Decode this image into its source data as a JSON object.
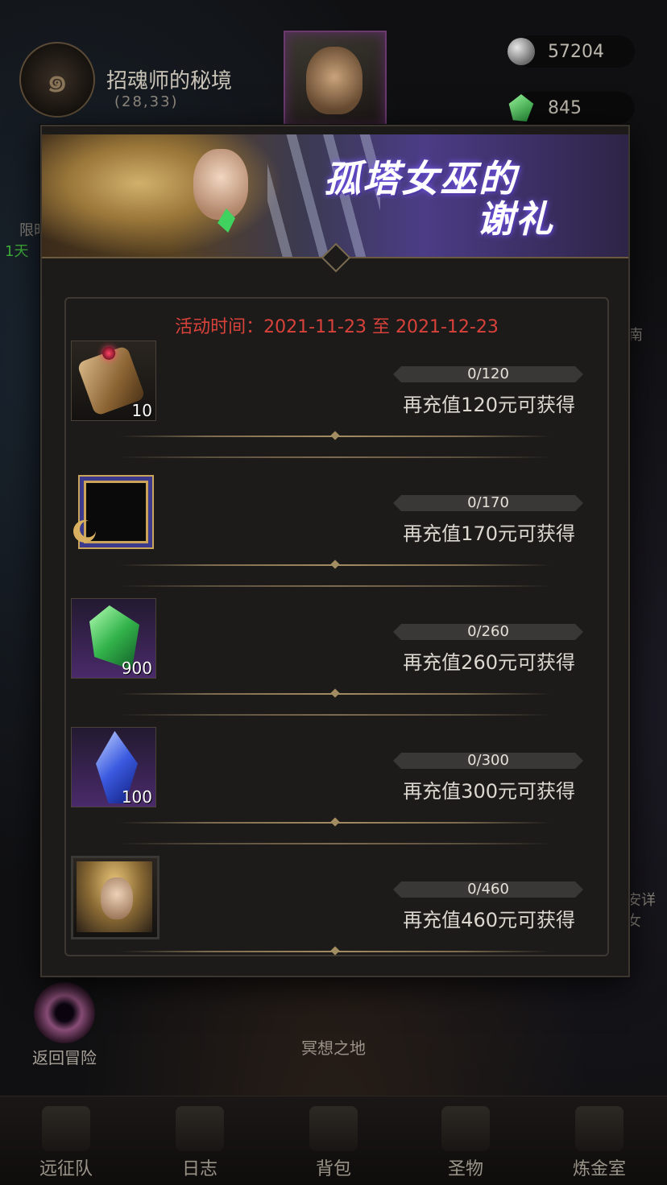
{
  "location": {
    "title": "招魂师的秘境",
    "coords": "(28,33)"
  },
  "currency": {
    "silver": "57204",
    "gem": "845"
  },
  "side_labels": {
    "left_1": "限时",
    "left_2": "1天",
    "right_1": "南",
    "right_2": "安详女"
  },
  "event": {
    "title_line1": "孤塔女巫的",
    "title_line2": "谢礼",
    "time": "活动时间：2021-11-23 至 2021-12-23"
  },
  "rewards": [
    {
      "item": "scroll-icon",
      "qty": "10",
      "progress": "0/120",
      "progress_fraction": 0,
      "requirement": "再充值120元可获得"
    },
    {
      "item": "avatar-frame-icon",
      "qty": "",
      "progress": "0/170",
      "progress_fraction": 0,
      "requirement": "再充值170元可获得"
    },
    {
      "item": "green-gem-icon",
      "qty": "900",
      "progress": "0/260",
      "progress_fraction": 0,
      "requirement": "再充值260元可获得"
    },
    {
      "item": "blue-crystal-icon",
      "qty": "100",
      "progress": "0/300",
      "progress_fraction": 0,
      "requirement": "再充值300元可获得"
    },
    {
      "item": "hero-portrait-icon",
      "qty": "",
      "progress": "0/460",
      "progress_fraction": 0,
      "requirement": "再充值460元可获得"
    }
  ],
  "background": {
    "return_label": "返回冒险",
    "area_label": "冥想之地"
  },
  "bottom_nav": [
    "远征队",
    "日志",
    "背包",
    "圣物",
    "炼金室"
  ],
  "colors": {
    "event_time": "#d8423a",
    "modal_bg": "#1c1b1a",
    "banner_purple": "#4b3c86"
  }
}
